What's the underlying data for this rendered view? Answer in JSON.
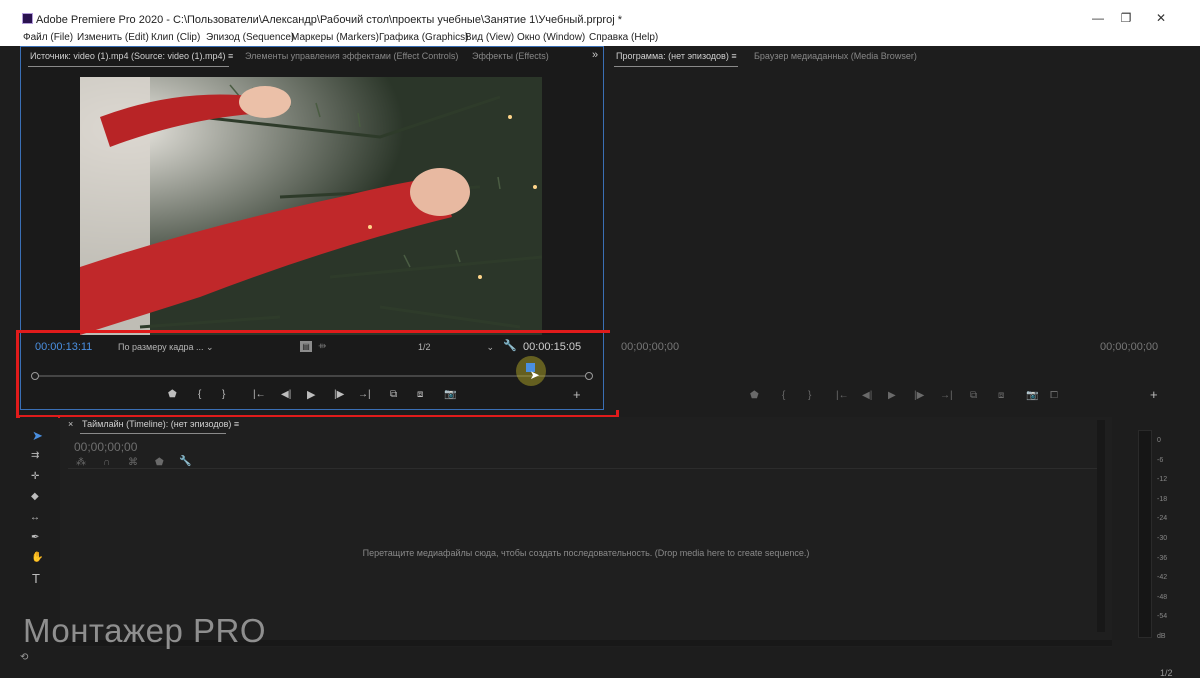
{
  "window": {
    "title": "Adobe Premiere Pro 2020 - C:\\Пользователи\\Александр\\Рабочий стол\\проекты учебные\\Занятие 1\\Учебный.prproj *"
  },
  "menu": [
    "Файл (File)",
    "Изменить (Edit)",
    "Клип (Clip)",
    "Эпизод (Sequence)",
    "Маркеры (Markers)",
    "Графика (Graphics)",
    "Вид (View)",
    "Окно (Window)",
    "Справка (Help)"
  ],
  "source_panel": {
    "tabs": [
      "Источник: video (1).mp4 (Source: video (1).mp4)",
      "Элементы управления эффектами (Effect Controls)",
      "Эффекты (Effects)"
    ],
    "menu_icon": "≡",
    "overflow_icon": "»",
    "timecode_current": "00:00:13:11",
    "fit_dropdown": "По размеру кадра ...",
    "resolution_dropdown": "1/2",
    "timecode_duration": "00:00:15:05",
    "playhead_position": 0.893
  },
  "program_panel": {
    "tabs": [
      "Программа: (нет эпизодов)",
      "Браузер медиаданных (Media Browser)"
    ],
    "menu_icon": "≡",
    "timecode_left": "00;00;00;00",
    "timecode_right": "00;00;00;00"
  },
  "timeline_panel": {
    "close_icon": "×",
    "tab": "Таймлайн (Timeline): (нет эпизодов)",
    "menu_icon": "≡",
    "timecode": "00;00;00;00",
    "drop_hint": "Перетащите медиафайлы сюда, чтобы создать последовательность. (Drop media here to create sequence.)"
  },
  "audio_meter": {
    "ticks": [
      "0",
      "-6",
      "-12",
      "-18",
      "-24",
      "-30",
      "-36",
      "-42",
      "-48",
      "-54",
      "dB"
    ]
  },
  "watermark": "Монтажер PRO",
  "bottom_right_text": "1/2",
  "colors": {
    "accent_blue": "#4a8fe0",
    "highlight_red": "#e01b1b",
    "panel_bg": "#1d1d1d"
  }
}
